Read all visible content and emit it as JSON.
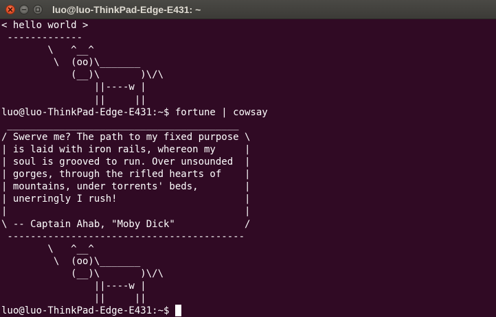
{
  "window": {
    "title": "luo@luo-ThinkPad-Edge-E431: ~",
    "buttons": {
      "close_icon": "close-icon",
      "minimize_icon": "minimize-icon",
      "maximize_icon": "maximize-icon"
    }
  },
  "terminal": {
    "colors": {
      "background": "#300a24",
      "foreground": "#ffffff"
    },
    "lines": [
      "< hello world >",
      " -------------",
      "        \\   ^__^",
      "         \\  (oo)\\_______",
      "            (__)\\       )\\/\\",
      "                ||----w |",
      "                ||     ||",
      "luo@luo-ThinkPad-Edge-E431:~$ fortune | cowsay",
      " ________________________________________",
      "/ Swerve me? The path to my fixed purpose \\",
      "| is laid with iron rails, whereon my     |",
      "| soul is grooved to run. Over unsounded  |",
      "| gorges, through the rifled hearts of    |",
      "| mountains, under torrents' beds,        |",
      "| unerringly I rush!                      |",
      "|                                         |",
      "\\ -- Captain Ahab, \"Moby Dick\"            /",
      " -----------------------------------------",
      "        \\   ^__^",
      "         \\  (oo)\\_______",
      "            (__)\\       )\\/\\",
      "                ||----w |",
      "                ||     ||"
    ],
    "prompt": "luo@luo-ThinkPad-Edge-E431:~$"
  }
}
